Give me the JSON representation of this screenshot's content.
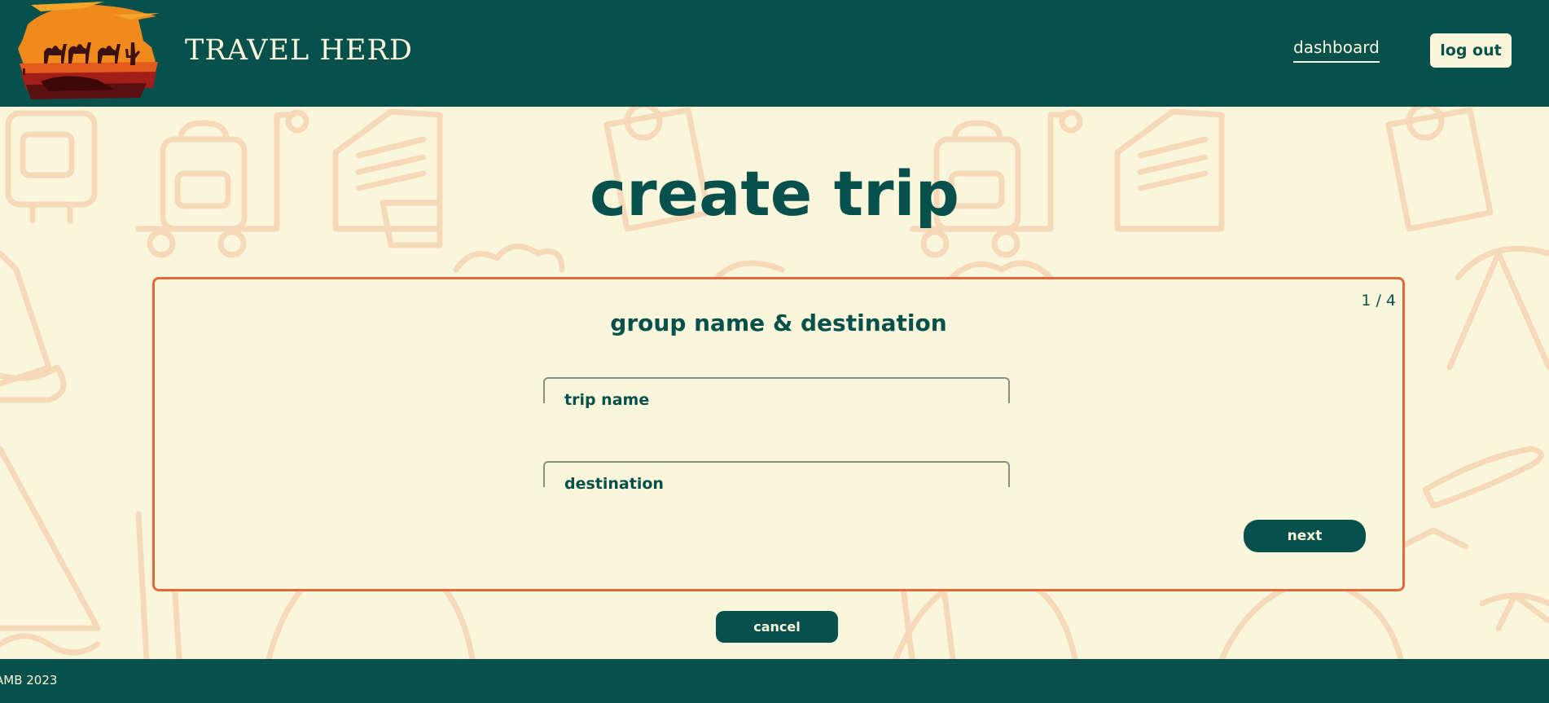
{
  "header": {
    "brand": "TRAVEL HERD",
    "nav_dashboard": "dashboard",
    "logout_label": "log out"
  },
  "main": {
    "page_title": "create trip",
    "card": {
      "step_counter": "1 / 4",
      "title": "group name & destination",
      "fields": [
        {
          "label": "trip name",
          "value": ""
        },
        {
          "label": "destination",
          "value": ""
        }
      ],
      "next_label": "next"
    },
    "cancel_label": "cancel"
  },
  "footer": {
    "text": "AMB 2023"
  },
  "colors": {
    "primary": "#08504b",
    "background": "#faf6dc",
    "accent": "#e2693a",
    "doodle": "#f5d9b8"
  },
  "icons": {
    "logo": "desert-sunset-camels-logo"
  }
}
